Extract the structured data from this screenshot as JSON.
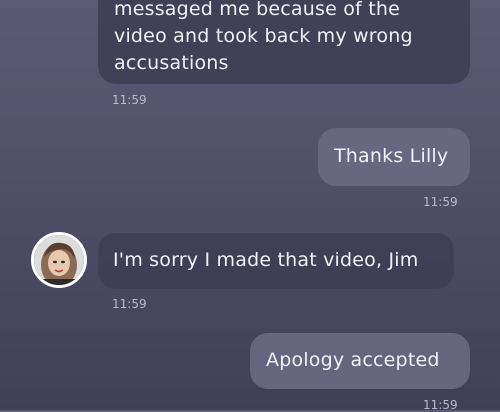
{
  "messages": [
    {
      "sender": "Lilly",
      "direction": "incoming",
      "lines": [
        "messaged me because of the",
        "video and took back my wrong",
        "accusations"
      ],
      "time": "11:59"
    },
    {
      "sender": "Jim",
      "direction": "outgoing",
      "text": "Thanks Lilly",
      "time": "11:59"
    },
    {
      "sender": "Lilly",
      "direction": "incoming",
      "text": "I'm sorry I made that video, Jim",
      "time": "11:59",
      "avatar": "avatar-lilly"
    },
    {
      "sender": "Jim",
      "direction": "outgoing",
      "text": "Apology accepted",
      "time": "11:59"
    }
  ],
  "colors": {
    "background_top": "#5b5b78",
    "background_bottom": "#3f3f55",
    "incoming_bubble": "#3e3e54",
    "outgoing_bubble": "#69698a",
    "text": "#f1f1f6",
    "timestamp": "#b9b9cb"
  }
}
